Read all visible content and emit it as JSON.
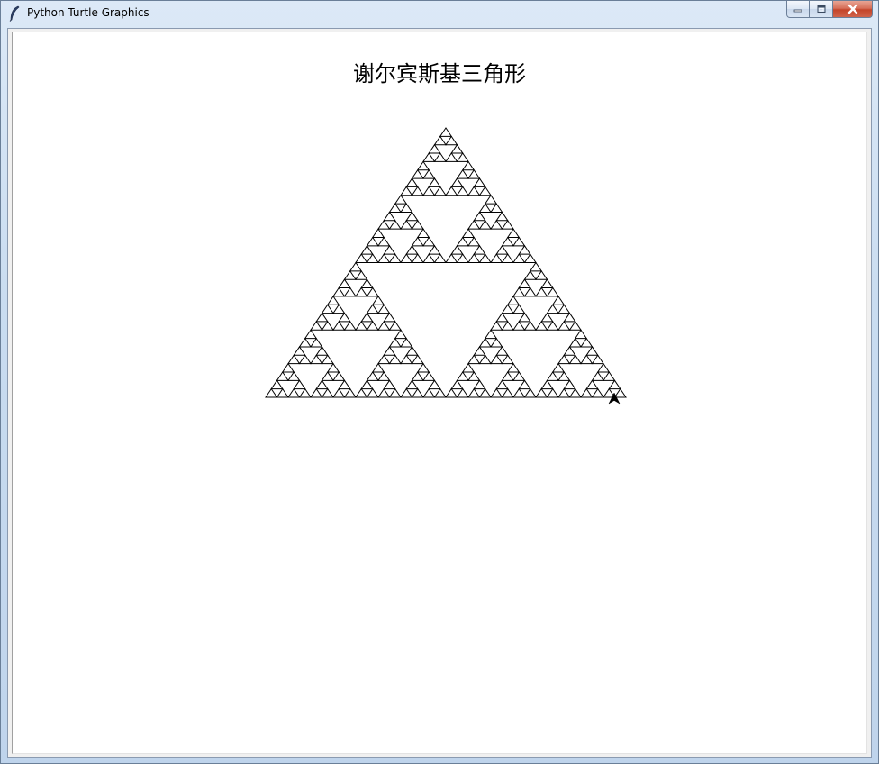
{
  "window": {
    "title": "Python Turtle Graphics",
    "icon": "feather-icon"
  },
  "caption_buttons": {
    "minimize_icon": "minimize-icon",
    "maximize_icon": "maximize-icon",
    "close_icon": "close-icon"
  },
  "canvas": {
    "title": "谢尔宾斯基三角形",
    "fractal": "sierpinski-triangle",
    "recursion_depth": 5,
    "stroke_color": "#000000",
    "background_color": "#ffffff",
    "turtle_cursor": "arrow-cursor-icon"
  }
}
